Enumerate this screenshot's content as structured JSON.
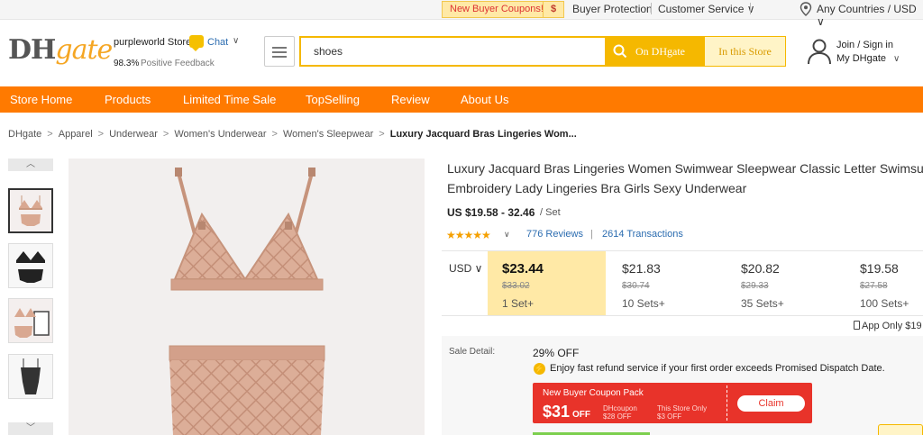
{
  "topbar": {
    "coupon_label": "New Buyer Coupons!",
    "coupon_icon": "$",
    "buyer_protection": "Buyer Protection",
    "customer_service": "Customer Service ∨",
    "location": "Any Countries / USD ∨"
  },
  "header": {
    "logo_dh": "DH",
    "logo_gate": "gate",
    "store_name": "purpleworld Store",
    "chat_label": "Chat",
    "feedback_pct": "98.3%",
    "feedback_label": "Positive Feedback",
    "search_value": "shoes",
    "search_button": "On DHgate",
    "store_search_button": "In this Store",
    "join_text": "Join / Sign in",
    "my_dhgate": "My DHgate"
  },
  "store_nav": [
    "Store Home",
    "Products",
    "Limited Time Sale",
    "TopSelling",
    "Review",
    "About Us"
  ],
  "breadcrumb": [
    "DHgate",
    "Apparel",
    "Underwear",
    "Women's Underwear",
    "Women's Sleepwear",
    "Luxury Jacquard Bras Lingeries Wom..."
  ],
  "product": {
    "title_line1": "Luxury Jacquard Bras Lingeries Women Swimwear Sleepwear Classic Letter Swimsu",
    "title_line2": "Embroidery Lady Lingeries Bra Girls Sexy Underwear",
    "price_range": "US $19.58 - 32.46",
    "price_unit": "/ Set",
    "rating_stars": "★★★★★",
    "reviews": "776  Reviews",
    "separator": "|",
    "transactions": "2614  Transactions",
    "currency": "USD ∨",
    "tiers": [
      {
        "price": "$23.44",
        "orig": "$33.02",
        "qty": "1 Set+"
      },
      {
        "price": "$21.83",
        "orig": "$30.74",
        "qty": "10 Sets+"
      },
      {
        "price": "$20.82",
        "orig": "$29.33",
        "qty": "35 Sets+"
      },
      {
        "price": "$19.58",
        "orig": "$27.58",
        "qty": "100 Sets+"
      }
    ],
    "app_only": "App Only  $19"
  },
  "sale": {
    "label": "Sale Detail:",
    "off": "29% OFF",
    "refund": "Enjoy fast refund service if your first order exceeds Promised Dispatch Date.",
    "coupon_title": "New Buyer Coupon Pack",
    "coupon_amount": "$31",
    "coupon_off": "OFF",
    "dh_coupon_1": "DHcoupon",
    "dh_coupon_2": "$28 OFF",
    "store_coupon_1": "This Store Only",
    "store_coupon_2": "$3 OFF",
    "claim": "Claim"
  },
  "colors": {
    "orange": "#ff7a00",
    "yellow": "#f5b800",
    "red": "#e8332a",
    "link": "#2b6cb0"
  }
}
